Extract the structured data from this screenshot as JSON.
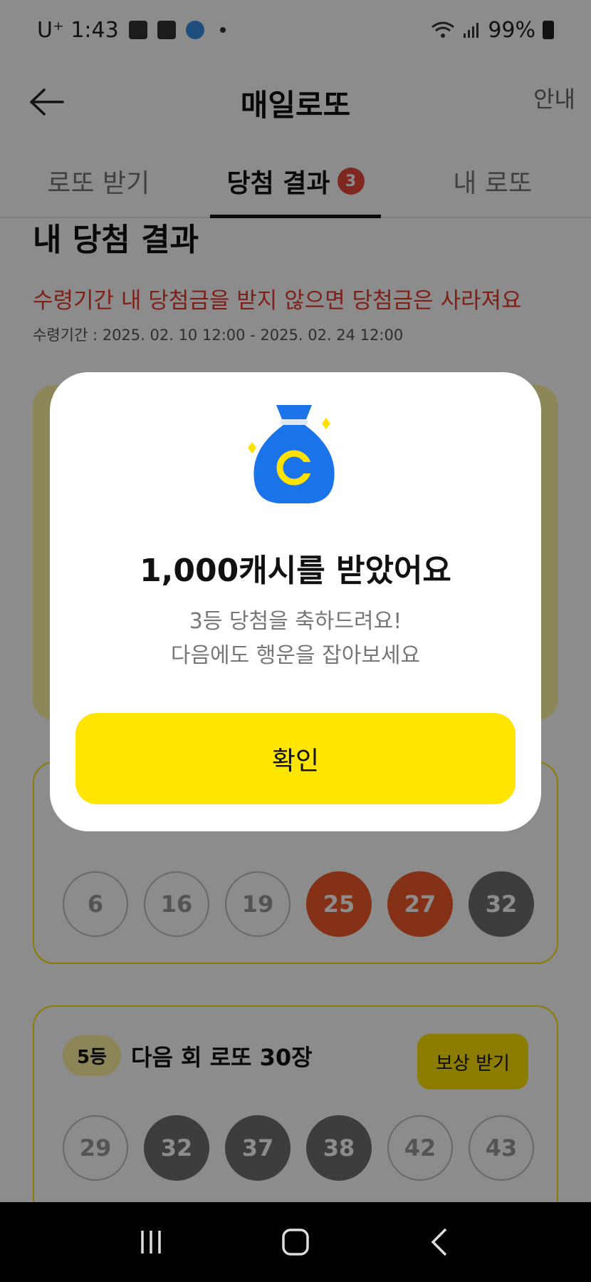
{
  "status_bar": {
    "carrier_time": "U⁺ 1:43",
    "battery": "99%"
  },
  "app_bar": {
    "title": "매일로또",
    "guide_label": "안내"
  },
  "tabs": [
    {
      "label": "로또 받기"
    },
    {
      "label": "당첨 결과",
      "badge": "3"
    },
    {
      "label": "내 로또"
    }
  ],
  "results": {
    "title": "내 당첨 결과",
    "warning": "수령기간 내 당첨금을 받지 않으면 당첨금은 사라져요",
    "period": "수령기간 : 2025. 02. 10 12:00 - 2025. 02. 24 12:00",
    "cards": [
      {
        "balls": [
          "6",
          "16",
          "19",
          "25",
          "27",
          "32"
        ]
      },
      {
        "rank": "5등",
        "prize": "다음 회 로또 30장",
        "button": "보상 받기",
        "balls": [
          "29",
          "32",
          "37",
          "38",
          "42",
          "43"
        ]
      }
    ]
  },
  "dialog": {
    "title": "1,000캐시를 받았어요",
    "line1": "3등 당첨을 축하드려요!",
    "line2": "다음에도 행운을 잡아보세요",
    "confirm": "확인"
  },
  "colors": {
    "accent_yellow": "#ffe500",
    "warning_red": "#e53b2c",
    "ball_red": "#f05a2a",
    "ball_gray": "#707070",
    "bag_blue": "#1a73e8"
  }
}
